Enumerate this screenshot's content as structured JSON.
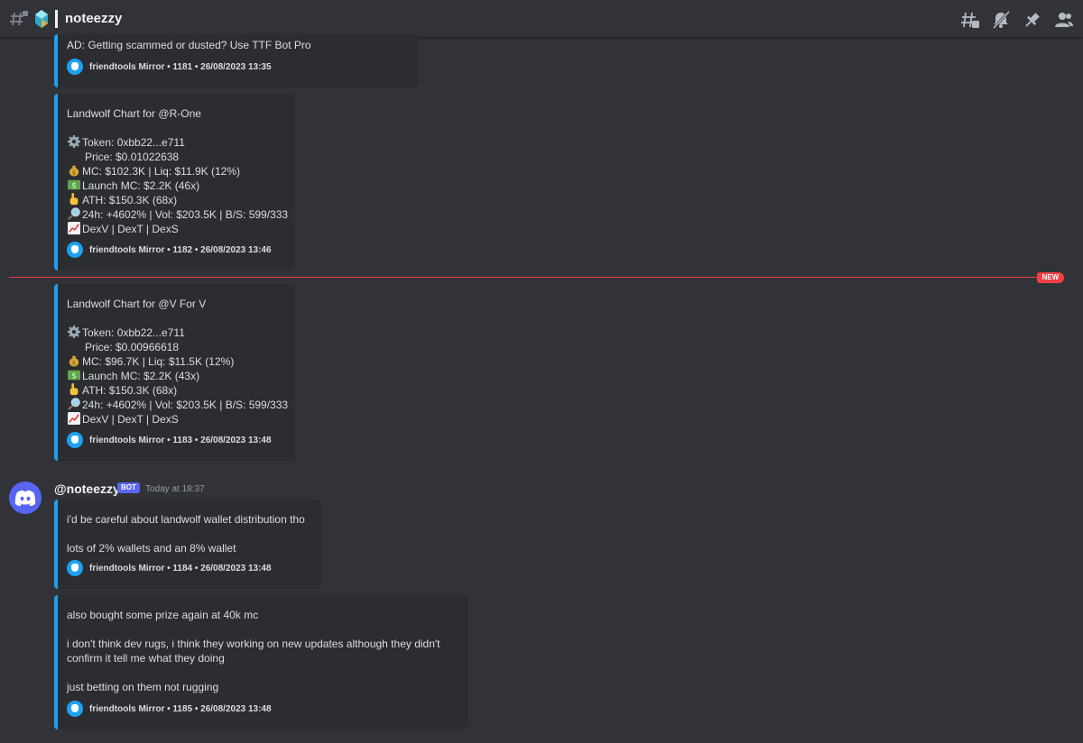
{
  "channel": {
    "title": "noteezzy"
  },
  "toolbar_icons": [
    "threads-icon",
    "mute-icon",
    "pin-icon",
    "members-icon"
  ],
  "accent_colors": {
    "embed_border": "#1da1f2",
    "new_divider": "#f23f43",
    "bot_badge": "#5865f2"
  },
  "embeds": [
    {
      "lines": [
        {
          "emoji": "",
          "text": "AD: Getting scammed or dusted? Use TTF Bot Pro"
        }
      ],
      "footer": "friendtools Mirror • 1181 • 26/08/2023 13:35"
    },
    {
      "lines": [
        {
          "emoji": "",
          "text": "Landwolf Chart for @R-One"
        },
        {
          "emoji": "",
          "text": ""
        },
        {
          "emoji": "gear",
          "text": "Token: 0xbb22...e711"
        },
        {
          "emoji": "",
          "text": "      Price: $0.01022638"
        },
        {
          "emoji": "moneybag",
          "text": "MC: $102.3K | Liq: $11.9K (12%)"
        },
        {
          "emoji": "dollar",
          "text": "Launch MC: $2.2K (46x)"
        },
        {
          "emoji": "point",
          "text": "ATH: $150.3K (68x)"
        },
        {
          "emoji": "magnifier",
          "text": "24h: +4602% | Vol: $203.5K | B/S: 599/333"
        },
        {
          "emoji": "chart",
          "text": "DexV | DexT | DexS"
        }
      ],
      "footer": "friendtools Mirror • 1182 • 26/08/2023 13:46"
    },
    {
      "lines": [
        {
          "emoji": "",
          "text": "Landwolf Chart for @V For V"
        },
        {
          "emoji": "",
          "text": ""
        },
        {
          "emoji": "gear",
          "text": "Token: 0xbb22...e711"
        },
        {
          "emoji": "",
          "text": "      Price: $0.00966618"
        },
        {
          "emoji": "moneybag",
          "text": "MC: $96.7K | Liq: $11.5K (12%)"
        },
        {
          "emoji": "dollar",
          "text": "Launch MC: $2.2K (43x)"
        },
        {
          "emoji": "point",
          "text": "ATH: $150.3K (68x)"
        },
        {
          "emoji": "magnifier",
          "text": "24h: +4602% | Vol: $203.5K | B/S: 599/333"
        },
        {
          "emoji": "chart",
          "text": "DexV | DexT | DexS"
        }
      ],
      "footer": "friendtools Mirror • 1183 • 26/08/2023 13:48"
    },
    {
      "lines": [
        {
          "emoji": "",
          "text": "i'd be careful about landwolf wallet distribution tho"
        },
        {
          "emoji": "",
          "text": ""
        },
        {
          "emoji": "",
          "text": "lots of 2% wallets and an 8% wallet"
        }
      ],
      "footer": "friendtools Mirror • 1184 • 26/08/2023 13:48"
    },
    {
      "lines": [
        {
          "emoji": "",
          "text": "also bought some prize again at 40k mc"
        },
        {
          "emoji": "",
          "text": ""
        },
        {
          "emoji": "",
          "text": "i don't think dev rugs, i think they working on new updates although they didn't"
        },
        {
          "emoji": "",
          "text": "confirm it tell me what they doing"
        },
        {
          "emoji": "",
          "text": ""
        },
        {
          "emoji": "",
          "text": "just betting on them not rugging"
        }
      ],
      "footer": "friendtools Mirror • 1185 • 26/08/2023 13:48"
    }
  ],
  "divider": {
    "label": "NEW"
  },
  "message": {
    "username": "@noteezzy",
    "badge": "BOT",
    "timestamp": "Today at 18:37"
  }
}
